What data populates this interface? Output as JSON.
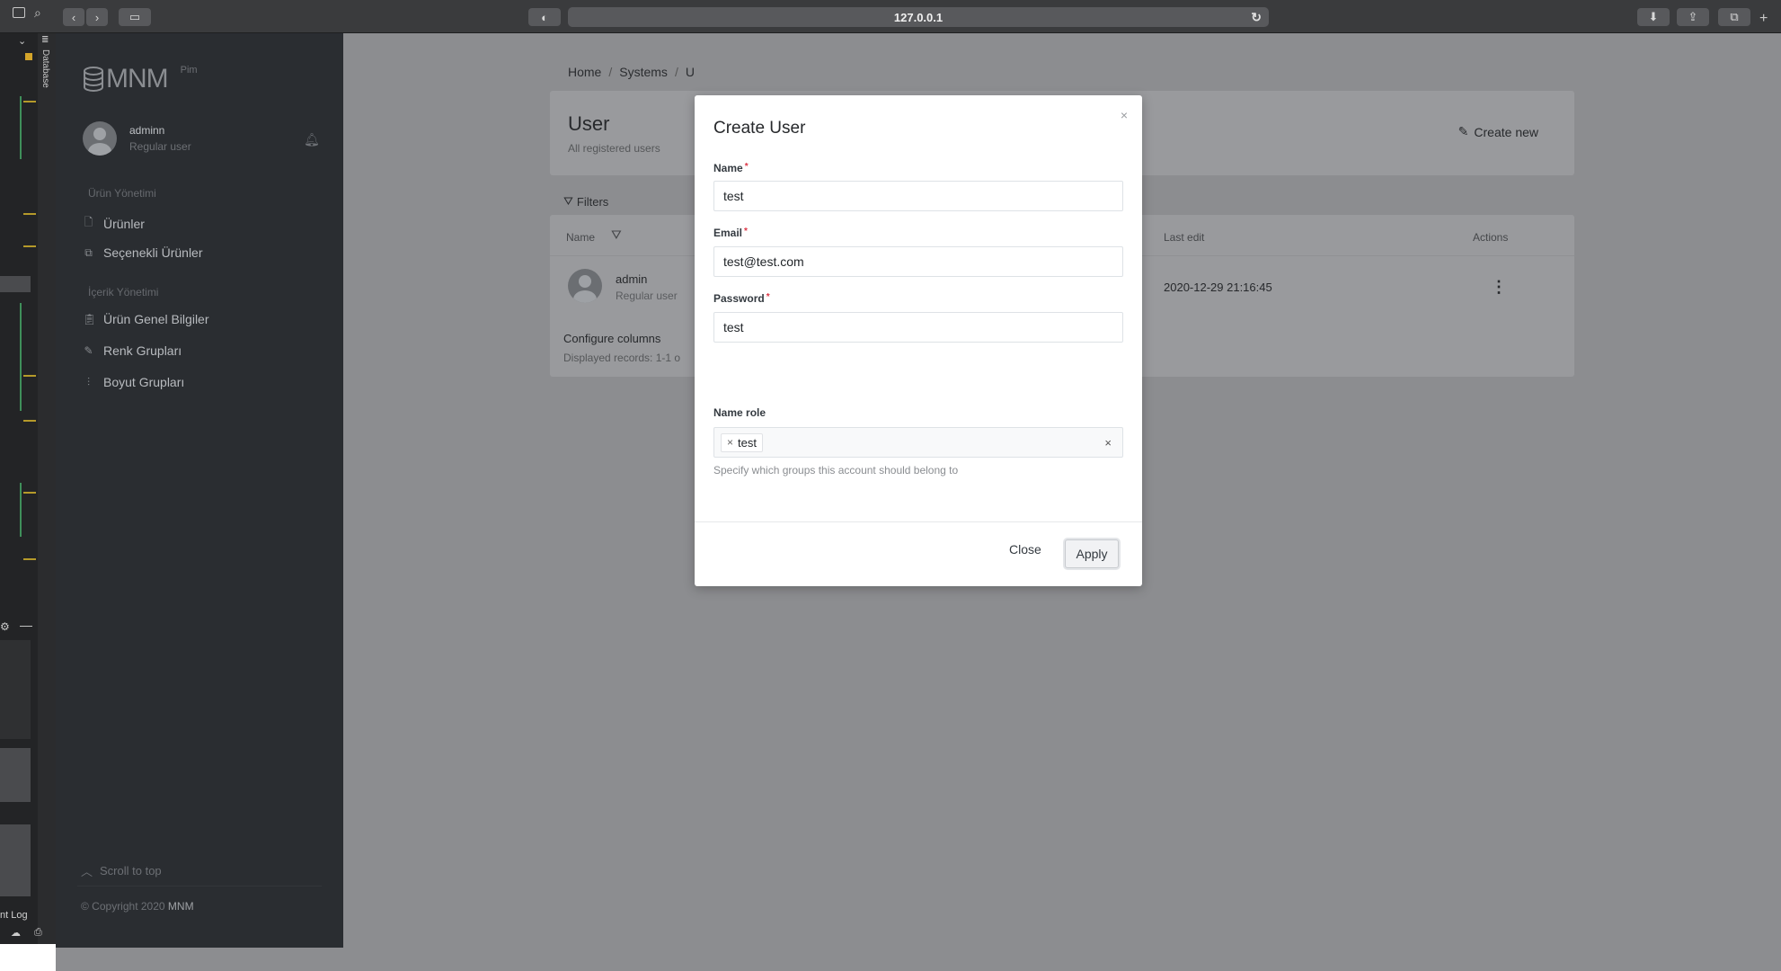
{
  "browser": {
    "url": "127.0.0.1"
  },
  "devtools": {
    "tab_label": "Database",
    "log_label": "nt Log"
  },
  "sidebar": {
    "logo": "MNM",
    "logo_sub": "Pim",
    "user_name": "adminn",
    "user_role": "Regular user",
    "sections": [
      {
        "title": "Ürün Yönetimi",
        "items": [
          {
            "label": "Ürünler",
            "icon": "file-icon"
          },
          {
            "label": "Seçenekli Ürünler",
            "icon": "copy-icon"
          }
        ]
      },
      {
        "title": "İçerik Yönetimi",
        "items": [
          {
            "label": "Ürün Genel Bilgiler",
            "icon": "clipboard-icon"
          },
          {
            "label": "Renk Grupları",
            "icon": "pencil-icon"
          },
          {
            "label": "Boyut Grupları",
            "icon": "sliders-icon"
          }
        ]
      }
    ],
    "scroll_to_top": "Scroll to top",
    "copyright_prefix": "© Copyright 2020",
    "copyright_brand": "MNM"
  },
  "main": {
    "breadcrumb": [
      "Home",
      "Systems",
      "U"
    ],
    "title": "User",
    "subtitle": "All registered users",
    "create_new": "Create new",
    "filters": "Filters",
    "table": {
      "headers": {
        "name": "Name",
        "last_edit": "Last edit",
        "actions": "Actions"
      },
      "rows": [
        {
          "name": "admin",
          "role": "Regular user",
          "last_edit": "2020-12-29 21:16:45"
        }
      ]
    },
    "configure_columns": "Configure columns",
    "displayed_records": "Displayed records: 1-1 o"
  },
  "modal": {
    "title": "Create User",
    "close_icon": "×",
    "fields": {
      "name": {
        "label": "Name",
        "value": "test"
      },
      "email": {
        "label": "Email",
        "value": "test@test.com"
      },
      "password": {
        "label": "Password",
        "value": "test"
      }
    },
    "role": {
      "label": "Name role",
      "tags": [
        "test"
      ],
      "help": "Specify which groups this account should belong to"
    },
    "close_button": "Close",
    "apply_button": "Apply"
  }
}
